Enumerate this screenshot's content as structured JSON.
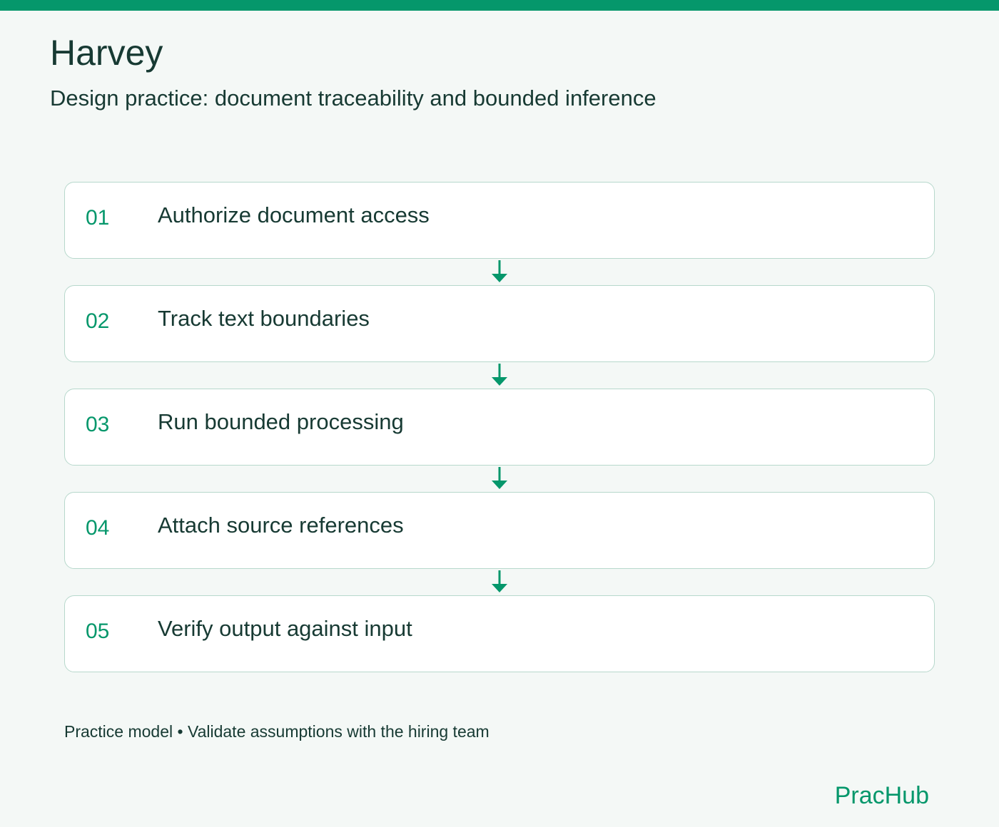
{
  "header": {
    "title": "Harvey",
    "subtitle": "Design practice: document traceability and bounded inference"
  },
  "steps": [
    {
      "number": "01",
      "label": "Authorize document access"
    },
    {
      "number": "02",
      "label": "Track text boundaries"
    },
    {
      "number": "03",
      "label": "Run bounded processing"
    },
    {
      "number": "04",
      "label": "Attach source references"
    },
    {
      "number": "05",
      "label": "Verify output against input"
    }
  ],
  "footer": {
    "note": "Practice model • Validate assumptions with the hiring team",
    "brand": "PracHub"
  },
  "colors": {
    "accent": "#05976b",
    "text": "#173a33",
    "background": "#f4f8f6",
    "card_border": "#b7d8cc"
  }
}
